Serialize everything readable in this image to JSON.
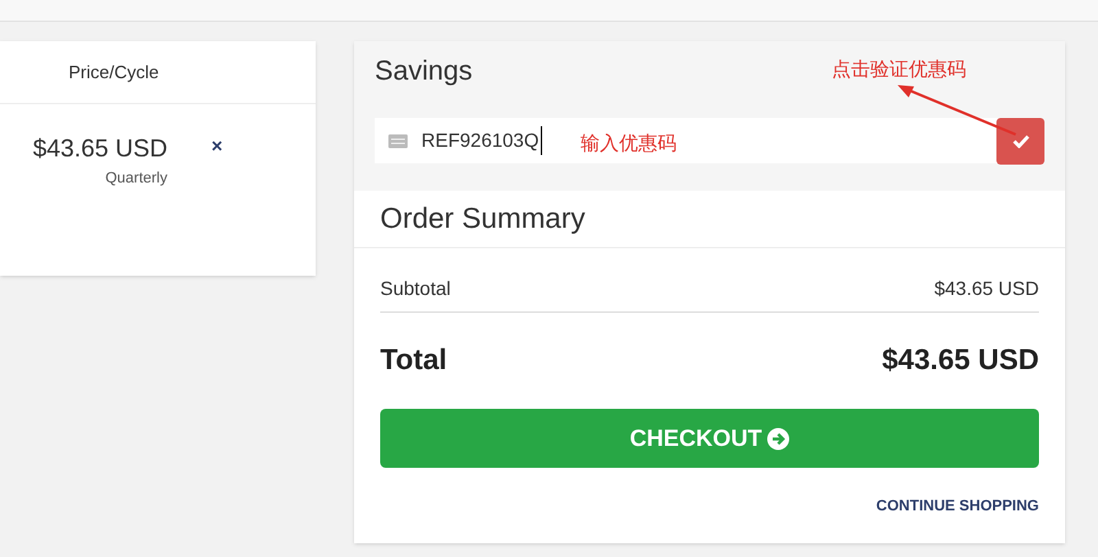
{
  "product_table": {
    "column_header": "Price/Cycle",
    "price": "$43.65 USD",
    "cycle": "Quarterly",
    "remove": "×"
  },
  "savings": {
    "title": "Savings",
    "promo_code": "REF926103Q"
  },
  "annotations": [
    {
      "text": "点击验证优惠码",
      "kind": "arrow"
    },
    {
      "text": "输入优惠码",
      "kind": "label"
    }
  ],
  "order_summary": {
    "title": "Order Summary",
    "subtotal_label": "Subtotal",
    "subtotal": "$43.65 USD",
    "total_label": "Total",
    "total": "$43.65 USD",
    "checkout": "CHECKOUT",
    "continue": "CONTINUE SHOPPING"
  }
}
